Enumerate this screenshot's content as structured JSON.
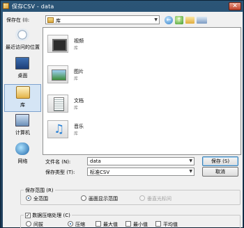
{
  "window": {
    "title": "保存CSV - data",
    "close": "✕"
  },
  "lookin": {
    "label": "保存在 (I):",
    "value": "库"
  },
  "places": [
    {
      "label": "最近访问的位置",
      "icon": "recent-places-icon"
    },
    {
      "label": "桌面",
      "icon": "desktop-icon"
    },
    {
      "label": "库",
      "icon": "libraries-icon"
    },
    {
      "label": "计算机",
      "icon": "computer-icon"
    },
    {
      "label": "网络",
      "icon": "network-icon"
    }
  ],
  "libraries": [
    {
      "name": "视频",
      "sub": "库",
      "icon": "video-library-icon"
    },
    {
      "name": "图片",
      "sub": "库",
      "icon": "pictures-library-icon"
    },
    {
      "name": "文档",
      "sub": "库",
      "icon": "documents-library-icon"
    },
    {
      "name": "音乐",
      "sub": "库",
      "icon": "music-library-icon"
    }
  ],
  "filename": {
    "label": "文件名 (N):",
    "value": "data"
  },
  "filetype": {
    "label": "保存类型 (T):",
    "value": "标准CSV"
  },
  "buttons": {
    "save": "保存 (S)",
    "cancel": "取消"
  },
  "range": {
    "title": "保存范围 (R)",
    "options": [
      "全范围",
      "画面显示范围",
      "垂直光标间"
    ],
    "selected": 0
  },
  "compress": {
    "checkbox_label": "数据压缩处理 (C)",
    "checked": true,
    "options": [
      "间拔",
      "压缩",
      "最大值",
      "最小值",
      "平均值"
    ],
    "selected": 1
  }
}
